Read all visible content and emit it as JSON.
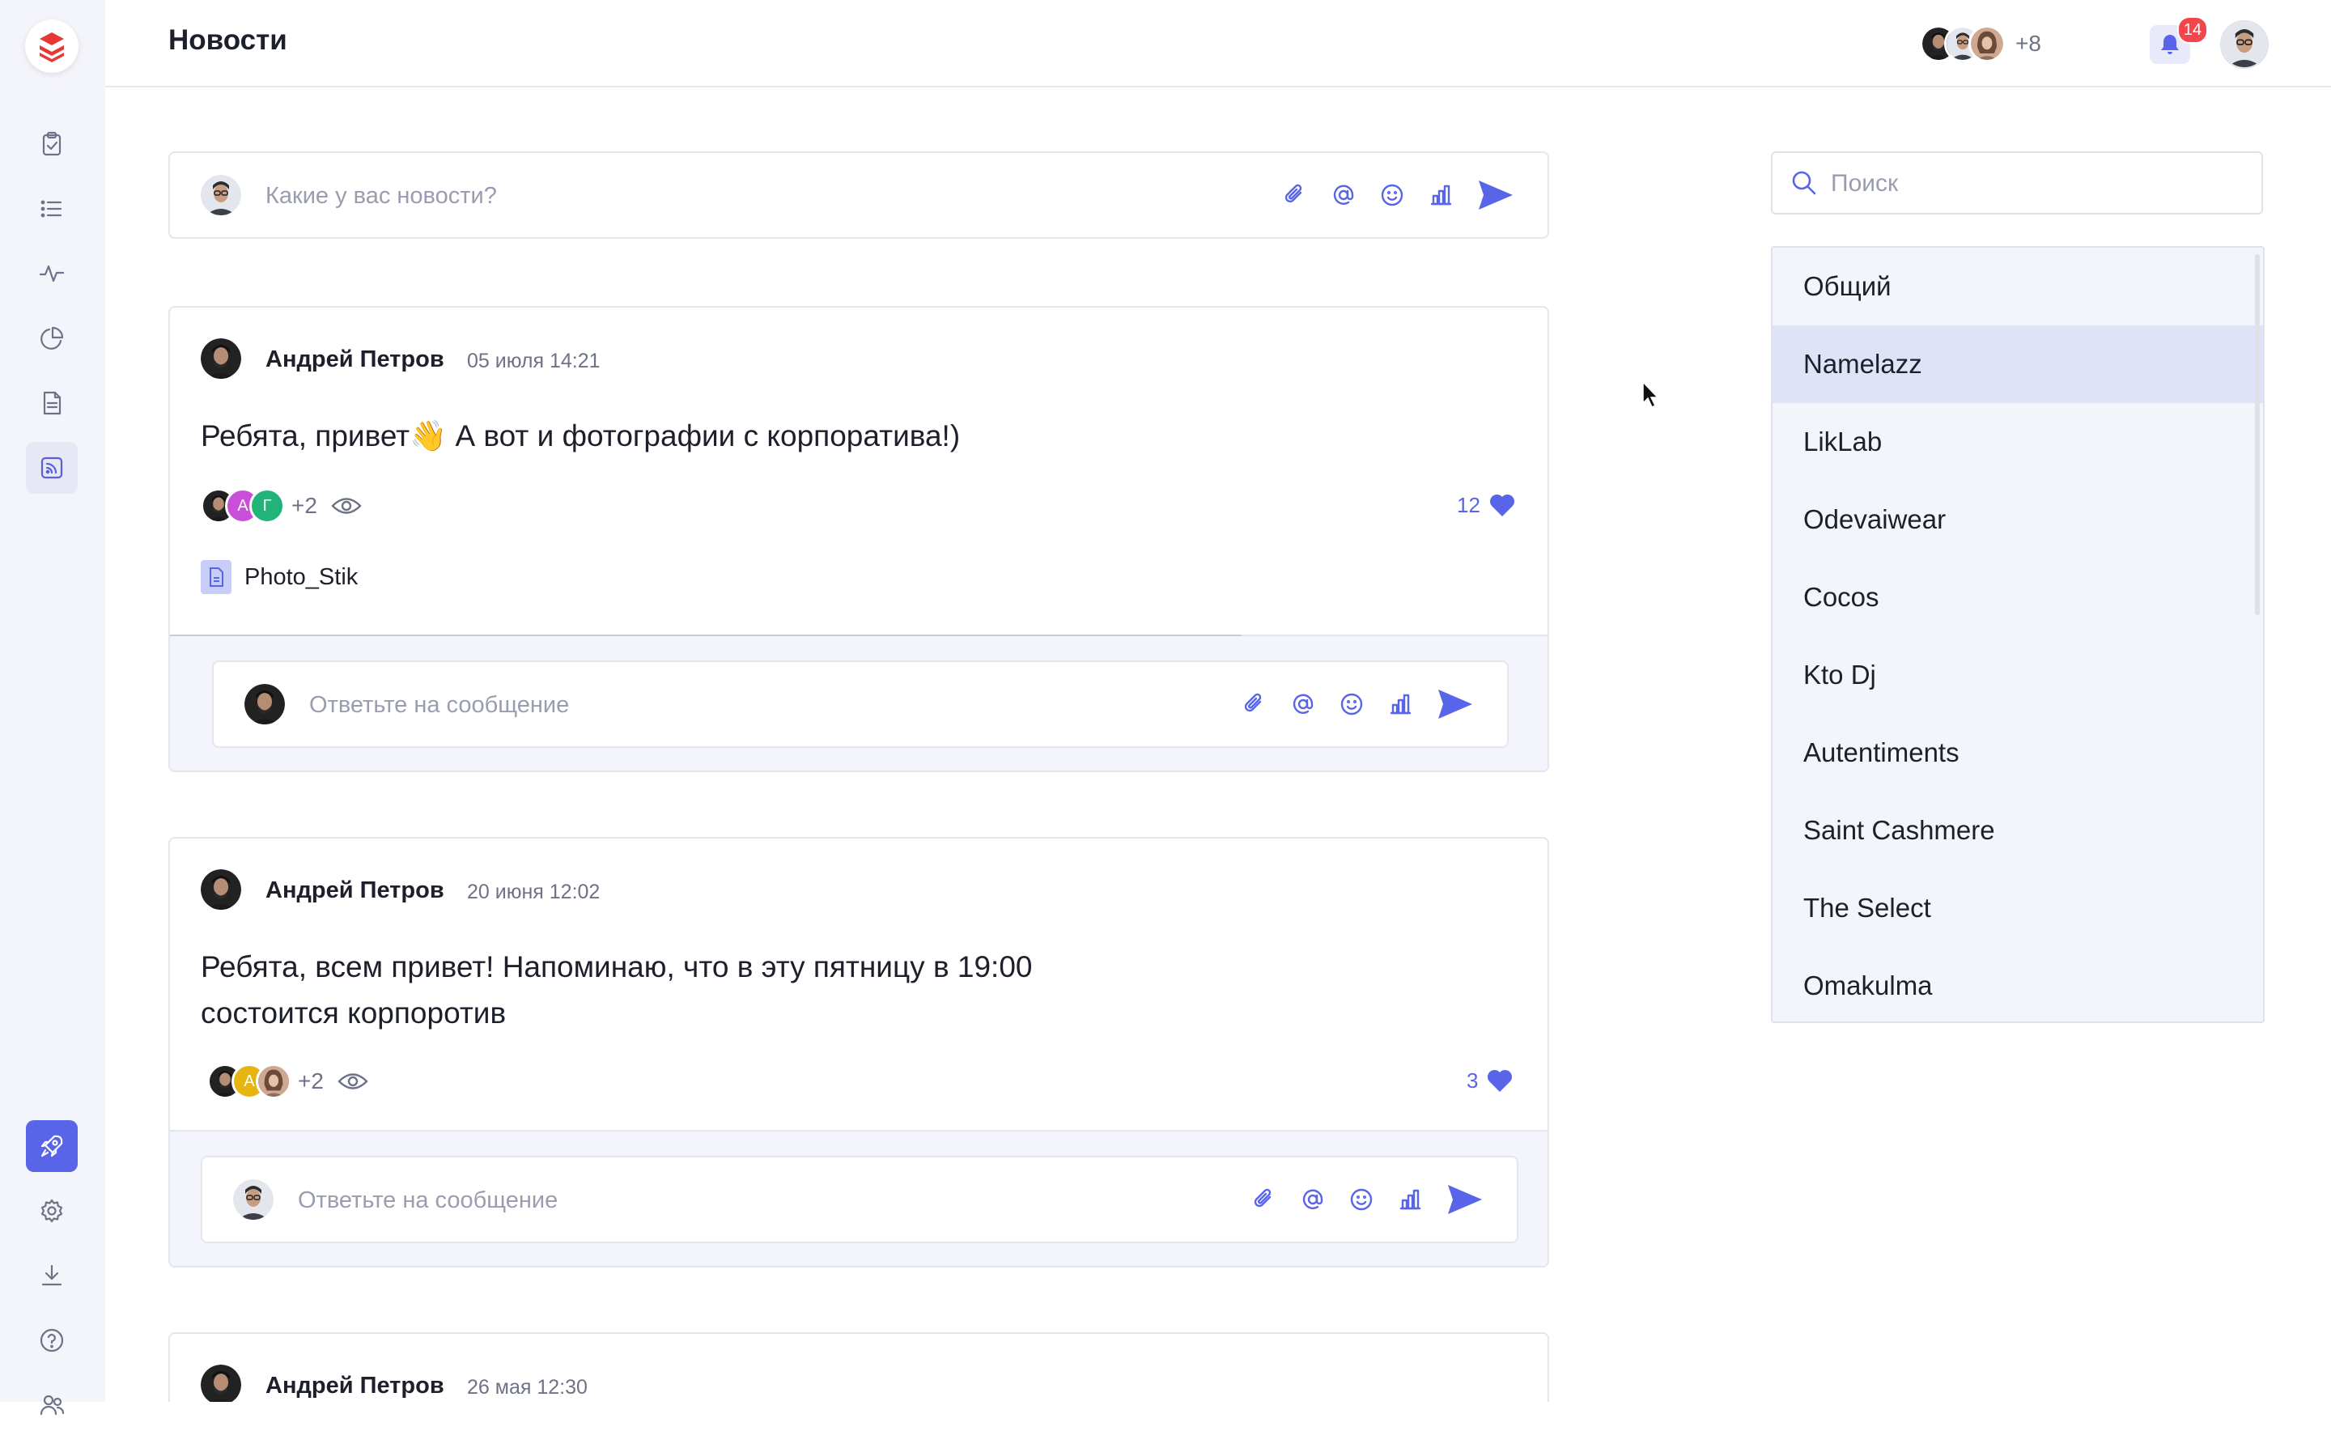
{
  "header": {
    "title": "Новости",
    "participants_more": "+8",
    "notifications_count": "14"
  },
  "composer": {
    "placeholder": "Какие у вас новости?"
  },
  "posts": [
    {
      "author": "Андрей Петров",
      "date": "05 июля 14:21",
      "text": "Ребята, привет👋 А вот и фотографии с корпоратива!)",
      "viewers_initials": [
        "",
        "А",
        "Г"
      ],
      "viewers_more": "+2",
      "likes": "12",
      "attachment": "Photo_Stik",
      "reply_placeholder": "Ответьте на сообщение"
    },
    {
      "author": "Андрей Петров",
      "date": "20 июня 12:02",
      "text": "Ребята, всем привет! Напоминаю, что в эту пятницу в 19:00 состоится корпоротив",
      "viewers_initials": [
        "",
        "А",
        ""
      ],
      "viewers_more": "+2",
      "likes": "3",
      "reply_placeholder": "Ответьте на сообщение"
    },
    {
      "author": "Андрей Петров",
      "date": "26 мая 12:30"
    }
  ],
  "search": {
    "placeholder": "Поиск"
  },
  "companies": [
    "Общий",
    "Namelazz",
    "LikLab",
    "Odevaiwear",
    "Cocos",
    "Kto Dj",
    "Autentiments",
    "Saint Cashmere",
    "The Select",
    "Omakulma"
  ],
  "selected_company": "Namelazz",
  "colors": {
    "accent": "#5865e8",
    "badge": "#f1464c",
    "logo": "#e53935"
  }
}
